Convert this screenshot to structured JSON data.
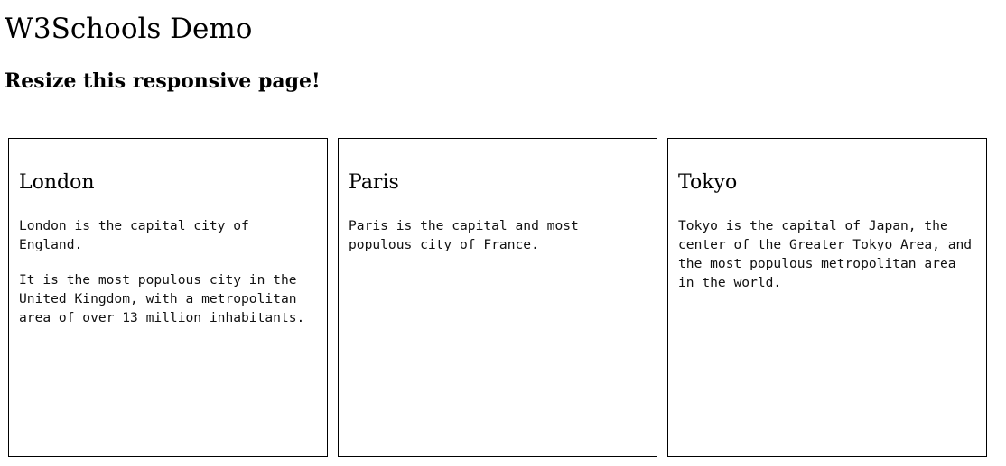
{
  "header": {
    "title": "W3Schools Demo",
    "subtitle": "Resize this responsive page!"
  },
  "cities": [
    {
      "name": "London",
      "paragraphs": [
        "London is the capital city of England.",
        "It is the most populous city in the United Kingdom, with a metropolitan area of over 13 million inhabitants."
      ]
    },
    {
      "name": "Paris",
      "paragraphs": [
        "Paris is the capital and most populous city of France."
      ]
    },
    {
      "name": "Tokyo",
      "paragraphs": [
        "Tokyo is the capital of Japan, the center of the Greater Tokyo Area, and the most populous metropolitan area in the world."
      ]
    }
  ]
}
